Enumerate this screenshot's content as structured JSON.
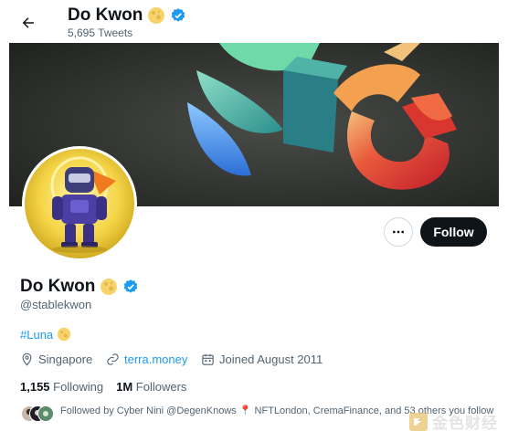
{
  "header": {
    "name": "Do Kwon",
    "tweet_count": "5,695 Tweets"
  },
  "actions": {
    "follow_label": "Follow"
  },
  "profile": {
    "name": "Do Kwon",
    "handle": "@stablekwon",
    "bio_hashtag": "#Luna",
    "location": "Singapore",
    "website": "terra.money",
    "joined": "Joined August 2011",
    "following_count": "1,155",
    "following_label": "Following",
    "followers_count": "1M",
    "followers_label": "Followers",
    "followed_by": "Followed by Cyber Nini @DegenKnows 📍 NFTLondon, CremaFinance, and 53 others you follow"
  },
  "watermark": {
    "text": "金色财经"
  },
  "colors": {
    "accent": "#1d9bf0",
    "verified": "#1d9bf0",
    "follow_bg": "#0f1419",
    "muted": "#536471",
    "moon": "#f7d36b"
  }
}
